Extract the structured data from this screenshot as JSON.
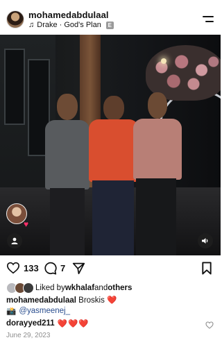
{
  "header": {
    "username": "mohamedabdulaal",
    "music_text": "Drake · God's Plan",
    "explicit_badge": "E"
  },
  "photo": {
    "sound_icon": "volume-icon",
    "tag_icon": "person-icon"
  },
  "actions": {
    "likes_count": "133",
    "comments_count": "7"
  },
  "likes": {
    "prefix": "Liked by ",
    "user": "wkhalaf",
    "and": " and ",
    "others": "others"
  },
  "caption": {
    "user": "mohamedabdulaal",
    "text": " Broskis ",
    "emoji": "❤️"
  },
  "mention": {
    "emoji": "📸",
    "handle": "@yasmeenej_"
  },
  "comment": {
    "user": "dorayyed211",
    "text": " ❤️❤️❤️"
  },
  "date": "June 29, 2023",
  "colors": {
    "accent_heart": "#e0182d",
    "mention_link": "#2a4e8f",
    "muted_text": "#8e8e8e"
  }
}
